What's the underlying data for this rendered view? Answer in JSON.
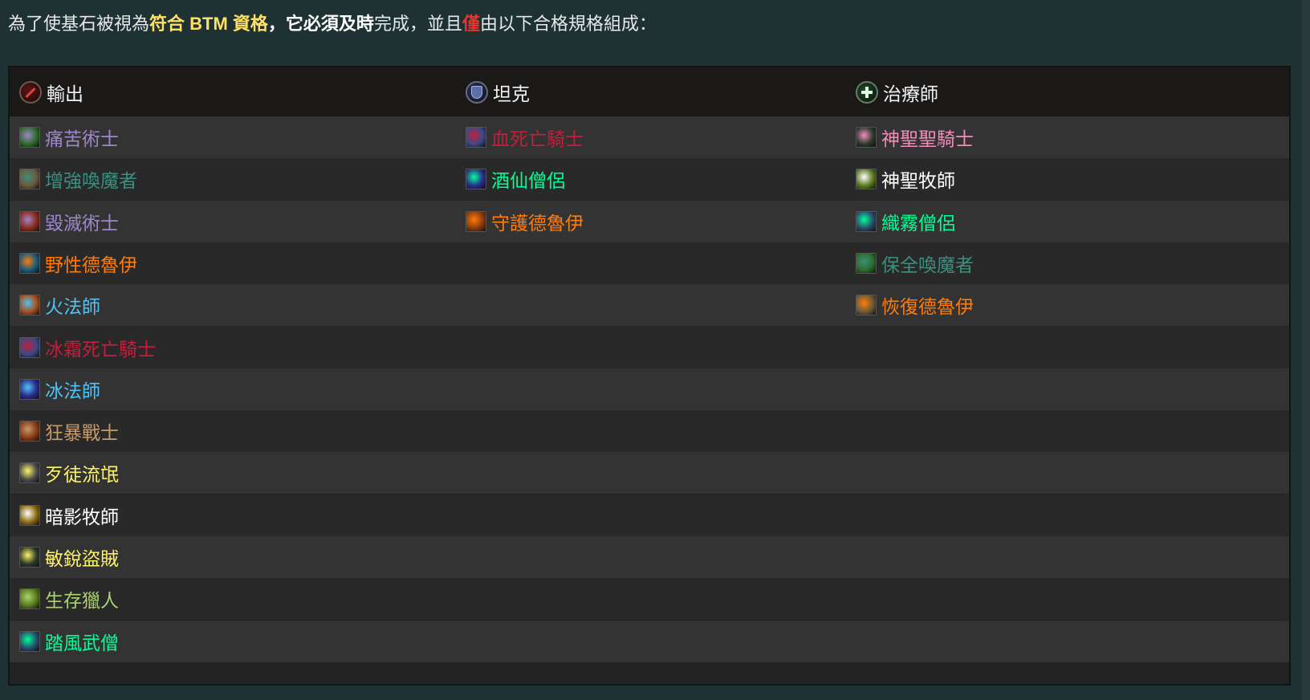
{
  "intro": {
    "part1": "為了使基石被視為",
    "qualify": "符合 BTM 資格",
    "comma1": "，",
    "must_on_time": "它必須及時",
    "part2": "完成，並且",
    "only": "僅",
    "part3": "由以下合格規格組成："
  },
  "table": {
    "headers": [
      {
        "label": "輸出",
        "icon": "dps-role-icon"
      },
      {
        "label": "坦克",
        "icon": "tank-role-icon"
      },
      {
        "label": "治療師",
        "icon": "healer-role-icon"
      }
    ],
    "dps": [
      {
        "label": "痛苦術士",
        "color": "#9d87c9",
        "icon": "affliction-warlock-icon"
      },
      {
        "label": "增強喚魔者",
        "color": "#3c8f7f",
        "icon": "augmentation-evoker-icon"
      },
      {
        "label": "毀滅術士",
        "color": "#9d87c9",
        "icon": "destruction-warlock-icon"
      },
      {
        "label": "野性德魯伊",
        "color": "#ff7c0a",
        "icon": "feral-druid-icon"
      },
      {
        "label": "火法師",
        "color": "#4fc3f7",
        "icon": "fire-mage-icon"
      },
      {
        "label": "冰霜死亡騎士",
        "color": "#c41e3a",
        "icon": "frost-death-knight-icon"
      },
      {
        "label": "冰法師",
        "color": "#4fc3f7",
        "icon": "frost-mage-icon"
      },
      {
        "label": "狂暴戰士",
        "color": "#c69b6d",
        "icon": "fury-warrior-icon"
      },
      {
        "label": "歹徒流氓",
        "color": "#fff468",
        "icon": "outlaw-rogue-icon"
      },
      {
        "label": "暗影牧師",
        "color": "#ffffff",
        "icon": "shadow-priest-icon"
      },
      {
        "label": "敏銳盜賊",
        "color": "#fff468",
        "icon": "subtlety-rogue-icon"
      },
      {
        "label": "生存獵人",
        "color": "#aad372",
        "icon": "survival-hunter-icon"
      },
      {
        "label": "踏風武僧",
        "color": "#00ff98",
        "icon": "windwalker-monk-icon"
      }
    ],
    "tank": [
      {
        "label": "血死亡騎士",
        "color": "#c41e3a",
        "icon": "blood-death-knight-icon"
      },
      {
        "label": "酒仙僧侶",
        "color": "#00ff98",
        "icon": "brewmaster-monk-icon"
      },
      {
        "label": "守護德魯伊",
        "color": "#ff7c0a",
        "icon": "guardian-druid-icon"
      }
    ],
    "healer": [
      {
        "label": "神聖聖騎士",
        "color": "#f48cba",
        "icon": "holy-paladin-icon"
      },
      {
        "label": "神聖牧師",
        "color": "#ffffff",
        "icon": "holy-priest-icon"
      },
      {
        "label": "織霧僧侶",
        "color": "#00ff98",
        "icon": "mistweaver-monk-icon"
      },
      {
        "label": "保全喚魔者",
        "color": "#3c8f7f",
        "icon": "preservation-evoker-icon"
      },
      {
        "label": "恢復德魯伊",
        "color": "#ff7c0a",
        "icon": "restoration-druid-icon"
      }
    ]
  }
}
